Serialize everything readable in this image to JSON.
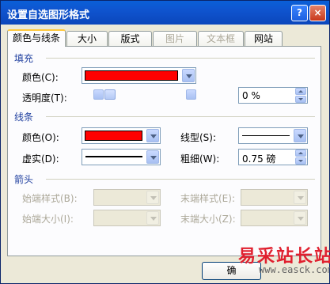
{
  "window": {
    "title": "设置自选图形格式",
    "help_label": "?",
    "close_label": "×"
  },
  "tabs": [
    {
      "label": "颜色与线条",
      "active": true,
      "enabled": true
    },
    {
      "label": "大小",
      "enabled": true
    },
    {
      "label": "版式",
      "enabled": true
    },
    {
      "label": "图片",
      "enabled": false
    },
    {
      "label": "文本框",
      "enabled": false
    },
    {
      "label": "网站",
      "enabled": true
    }
  ],
  "fill": {
    "section_label": "填充",
    "color_label": "颜色(C):",
    "color_value": "#ff0000",
    "transparency_label": "透明度(T):",
    "transparency_value": "0 %"
  },
  "line": {
    "section_label": "线条",
    "color_label": "颜色(O):",
    "color_value": "#ff0000",
    "dash_label": "虚实(D):",
    "style_label": "线型(S):",
    "weight_label": "粗细(W):",
    "weight_value": "0.75 磅"
  },
  "arrows": {
    "section_label": "箭头",
    "begin_style_label": "始端样式(B):",
    "end_style_label": "末端样式(E):",
    "begin_size_label": "始端大小(I):",
    "end_size_label": "末端大小(Z):"
  },
  "footer": {
    "ok_label": "确"
  },
  "watermark": {
    "brand": "易采站长站",
    "url": "www.easck.com"
  }
}
